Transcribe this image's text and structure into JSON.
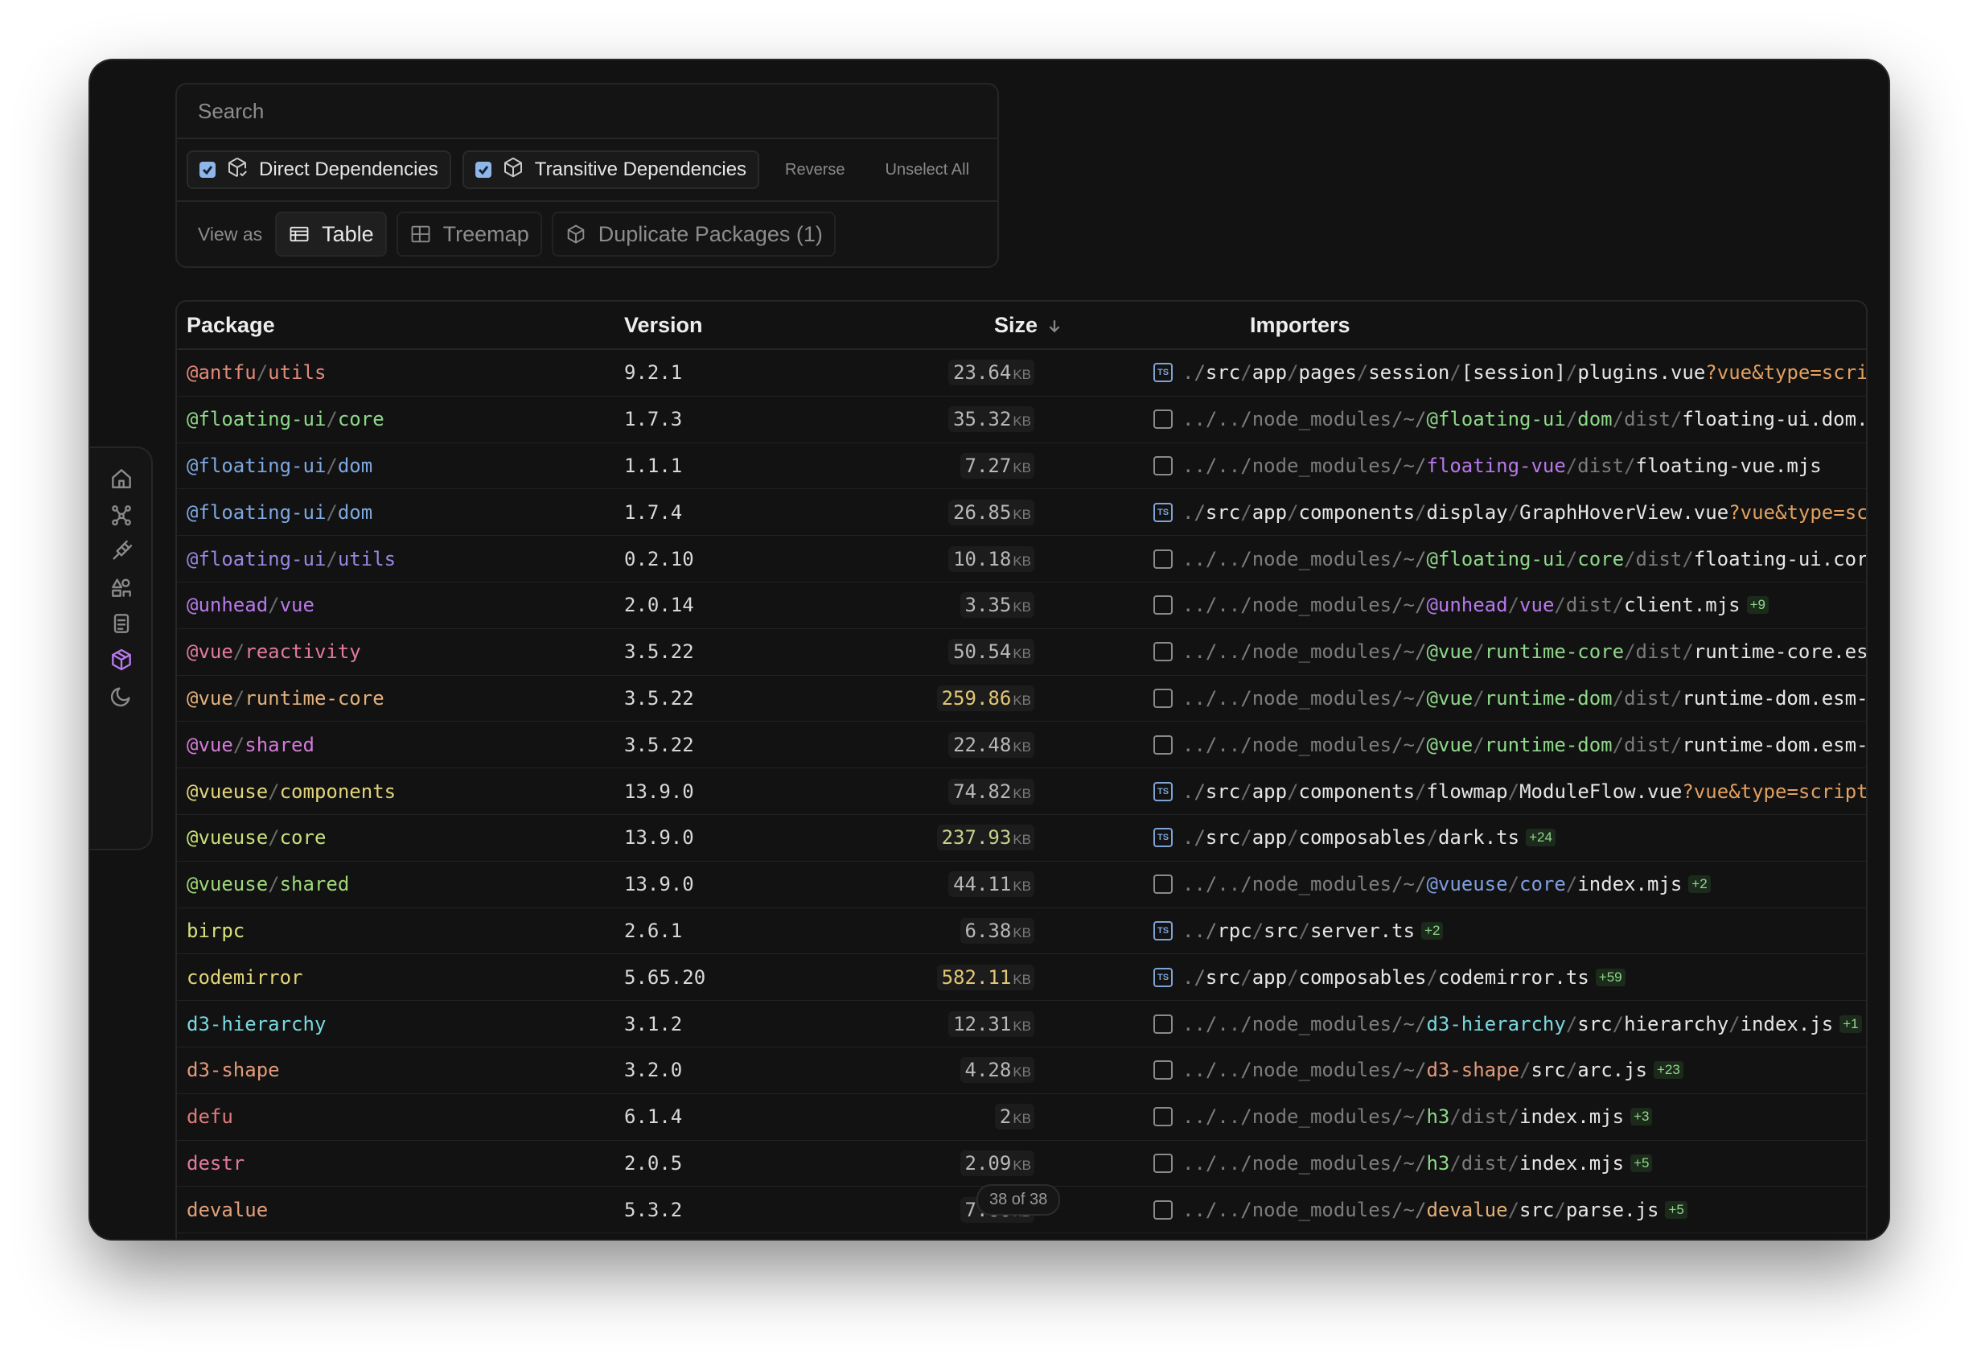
{
  "search": {
    "placeholder": "Search"
  },
  "filters": {
    "direct_label": "Direct Dependencies",
    "transitive_label": "Transitive Dependencies",
    "reverse_label": "Reverse",
    "unselect_label": "Unselect All"
  },
  "view": {
    "label": "View as",
    "table": "Table",
    "treemap": "Treemap",
    "duplicates": "Duplicate Packages (1)"
  },
  "rail": {
    "items": [
      "home-icon",
      "graph-icon",
      "plugin-icon",
      "assets-icon",
      "docs-icon",
      "packages-icon",
      "moon-icon"
    ],
    "active": "packages-icon"
  },
  "table": {
    "headers": {
      "package": "Package",
      "version": "Version",
      "size": "Size",
      "importers": "Importers"
    },
    "rows": [
      {
        "scope": "@antfu",
        "name": "utils",
        "color": "#e28a7a",
        "version": "9.2.1",
        "size": "23.64",
        "unit": "KB",
        "tone": "",
        "file": "ts",
        "importer": [
          [
            "./",
            "d"
          ],
          [
            "src",
            "t"
          ],
          [
            "/",
            "s"
          ],
          [
            "app",
            "t"
          ],
          [
            "/",
            "s"
          ],
          [
            "pages",
            "t"
          ],
          [
            "/",
            "s"
          ],
          [
            "session",
            "t"
          ],
          [
            "/",
            "s"
          ],
          [
            "[session]",
            "t"
          ],
          [
            "/",
            "s"
          ],
          [
            "plugins.vue",
            "t"
          ],
          [
            "?",
            "o"
          ],
          [
            "vue",
            "o"
          ],
          [
            "&",
            "o"
          ],
          [
            "type",
            "o"
          ],
          [
            "=script",
            "o"
          ]
        ],
        "extra": ""
      },
      {
        "scope": "@floating-ui",
        "name": "core",
        "color": "#8fd88a",
        "version": "1.7.3",
        "size": "35.32",
        "unit": "KB",
        "tone": "",
        "file": "js",
        "importer": [
          [
            "../../node_modules/~/",
            "d"
          ],
          [
            "@floating-ui",
            "g"
          ],
          [
            "/",
            "s"
          ],
          [
            "dom",
            "g"
          ],
          [
            "/",
            "s"
          ],
          [
            "dist",
            "d"
          ],
          [
            "/",
            "s"
          ],
          [
            "floating-ui.dom.mjs",
            "t"
          ]
        ],
        "extra": ""
      },
      {
        "scope": "@floating-ui",
        "name": "dom",
        "color": "#7fa8e0",
        "version": "1.1.1",
        "size": "7.27",
        "unit": "KB",
        "tone": "",
        "file": "js",
        "importer": [
          [
            "../../node_modules/~/",
            "d"
          ],
          [
            "floating-vue",
            "p"
          ],
          [
            "/",
            "s"
          ],
          [
            "dist",
            "d"
          ],
          [
            "/",
            "s"
          ],
          [
            "floating-vue.mjs",
            "t"
          ]
        ],
        "extra": ""
      },
      {
        "scope": "@floating-ui",
        "name": "dom",
        "color": "#7fa8e0",
        "version": "1.7.4",
        "size": "26.85",
        "unit": "KB",
        "tone": "",
        "file": "ts",
        "importer": [
          [
            "./",
            "d"
          ],
          [
            "src",
            "t"
          ],
          [
            "/",
            "s"
          ],
          [
            "app",
            "t"
          ],
          [
            "/",
            "s"
          ],
          [
            "components",
            "t"
          ],
          [
            "/",
            "s"
          ],
          [
            "display",
            "t"
          ],
          [
            "/",
            "s"
          ],
          [
            "GraphHoverView.vue",
            "t"
          ],
          [
            "?",
            "o"
          ],
          [
            "vue",
            "o"
          ],
          [
            "&",
            "o"
          ],
          [
            "type",
            "o"
          ],
          [
            "=script",
            "o"
          ]
        ],
        "extra": ""
      },
      {
        "scope": "@floating-ui",
        "name": "utils",
        "color": "#9a86e0",
        "version": "0.2.10",
        "size": "10.18",
        "unit": "KB",
        "tone": "",
        "file": "js",
        "importer": [
          [
            "../../node_modules/~/",
            "d"
          ],
          [
            "@floating-ui",
            "g"
          ],
          [
            "/",
            "s"
          ],
          [
            "core",
            "g"
          ],
          [
            "/",
            "s"
          ],
          [
            "dist",
            "d"
          ],
          [
            "/",
            "s"
          ],
          [
            "floating-ui.core.mjs",
            "t"
          ]
        ],
        "extra": ""
      },
      {
        "scope": "@unhead",
        "name": "vue",
        "color": "#b779ea",
        "version": "2.0.14",
        "size": "3.35",
        "unit": "KB",
        "tone": "",
        "file": "js",
        "importer": [
          [
            "../../node_modules/~/",
            "d"
          ],
          [
            "@unhead",
            "p"
          ],
          [
            "/",
            "s"
          ],
          [
            "vue",
            "p"
          ],
          [
            "/",
            "s"
          ],
          [
            "dist",
            "d"
          ],
          [
            "/",
            "s"
          ],
          [
            "client.mjs",
            "t"
          ]
        ],
        "extra": "+9"
      },
      {
        "scope": "@vue",
        "name": "reactivity",
        "color": "#e47a9c",
        "version": "3.5.22",
        "size": "50.54",
        "unit": "KB",
        "tone": "",
        "file": "js",
        "importer": [
          [
            "../../node_modules/~/",
            "d"
          ],
          [
            "@vue",
            "g"
          ],
          [
            "/",
            "s"
          ],
          [
            "runtime-core",
            "g"
          ],
          [
            "/",
            "s"
          ],
          [
            "dist",
            "d"
          ],
          [
            "/",
            "s"
          ],
          [
            "runtime-core.esm-bundler.js",
            "t"
          ]
        ],
        "extra": ""
      },
      {
        "scope": "@vue",
        "name": "runtime-core",
        "color": "#e2b07a",
        "version": "3.5.22",
        "size": "259.86",
        "unit": "KB",
        "tone": "big",
        "file": "js",
        "importer": [
          [
            "../../node_modules/~/",
            "d"
          ],
          [
            "@vue",
            "g"
          ],
          [
            "/",
            "s"
          ],
          [
            "runtime-dom",
            "g"
          ],
          [
            "/",
            "s"
          ],
          [
            "dist",
            "d"
          ],
          [
            "/",
            "s"
          ],
          [
            "runtime-dom.esm-bundler.js",
            "t"
          ]
        ],
        "extra": ""
      },
      {
        "scope": "@vue",
        "name": "shared",
        "color": "#d37ad8",
        "version": "3.5.22",
        "size": "22.48",
        "unit": "KB",
        "tone": "",
        "file": "js",
        "importer": [
          [
            "../../node_modules/~/",
            "d"
          ],
          [
            "@vue",
            "g"
          ],
          [
            "/",
            "s"
          ],
          [
            "runtime-dom",
            "g"
          ],
          [
            "/",
            "s"
          ],
          [
            "dist",
            "d"
          ],
          [
            "/",
            "s"
          ],
          [
            "runtime-dom.esm-bundler.js",
            "t"
          ]
        ],
        "extra": ""
      },
      {
        "scope": "@vueuse",
        "name": "components",
        "color": "#e2d47a",
        "version": "13.9.0",
        "size": "74.82",
        "unit": "KB",
        "tone": "",
        "file": "ts",
        "importer": [
          [
            "./",
            "d"
          ],
          [
            "src",
            "t"
          ],
          [
            "/",
            "s"
          ],
          [
            "app",
            "t"
          ],
          [
            "/",
            "s"
          ],
          [
            "components",
            "t"
          ],
          [
            "/",
            "s"
          ],
          [
            "flowmap",
            "t"
          ],
          [
            "/",
            "s"
          ],
          [
            "ModuleFlow.vue",
            "t"
          ],
          [
            "?",
            "o"
          ],
          [
            "vue",
            "o"
          ],
          [
            "&",
            "o"
          ],
          [
            "type",
            "o"
          ],
          [
            "=script",
            "o"
          ]
        ],
        "extra": ""
      },
      {
        "scope": "@vueuse",
        "name": "core",
        "color": "#c7e07a",
        "version": "13.9.0",
        "size": "237.93",
        "unit": "KB",
        "tone": "mid",
        "file": "ts",
        "importer": [
          [
            "./",
            "d"
          ],
          [
            "src",
            "t"
          ],
          [
            "/",
            "s"
          ],
          [
            "app",
            "t"
          ],
          [
            "/",
            "s"
          ],
          [
            "composables",
            "t"
          ],
          [
            "/",
            "s"
          ],
          [
            "dark.ts",
            "t"
          ]
        ],
        "extra": "+24"
      },
      {
        "scope": "@vueuse",
        "name": "shared",
        "color": "#9ed87a",
        "version": "13.9.0",
        "size": "44.11",
        "unit": "KB",
        "tone": "",
        "file": "js",
        "importer": [
          [
            "../../node_modules/~/",
            "d"
          ],
          [
            "@vueuse",
            "b"
          ],
          [
            "/",
            "s"
          ],
          [
            "core",
            "b"
          ],
          [
            "/",
            "s"
          ],
          [
            "index.mjs",
            "t"
          ]
        ],
        "extra": "+2"
      },
      {
        "scope": "",
        "name": "birpc",
        "color": "#d8e07a",
        "version": "2.6.1",
        "size": "6.38",
        "unit": "KB",
        "tone": "",
        "file": "ts",
        "importer": [
          [
            "../",
            "d"
          ],
          [
            "rpc",
            "t"
          ],
          [
            "/",
            "s"
          ],
          [
            "src",
            "t"
          ],
          [
            "/",
            "s"
          ],
          [
            "server.ts",
            "t"
          ]
        ],
        "extra": "+2"
      },
      {
        "scope": "",
        "name": "codemirror",
        "color": "#e2d47a",
        "version": "5.65.20",
        "size": "582.11",
        "unit": "KB",
        "tone": "big",
        "file": "ts",
        "importer": [
          [
            "./",
            "d"
          ],
          [
            "src",
            "t"
          ],
          [
            "/",
            "s"
          ],
          [
            "app",
            "t"
          ],
          [
            "/",
            "s"
          ],
          [
            "composables",
            "t"
          ],
          [
            "/",
            "s"
          ],
          [
            "codemirror.ts",
            "t"
          ]
        ],
        "extra": "+59"
      },
      {
        "scope": "",
        "name": "d3-hierarchy",
        "color": "#7ad8e0",
        "version": "3.1.2",
        "size": "12.31",
        "unit": "KB",
        "tone": "",
        "file": "js",
        "importer": [
          [
            "../../node_modules/~/",
            "d"
          ],
          [
            "d3-hierarchy",
            "c"
          ],
          [
            "/",
            "s"
          ],
          [
            "src",
            "t"
          ],
          [
            "/",
            "s"
          ],
          [
            "hierarchy",
            "t"
          ],
          [
            "/",
            "s"
          ],
          [
            "index.js",
            "t"
          ]
        ],
        "extra": "+1"
      },
      {
        "scope": "",
        "name": "d3-shape",
        "color": "#e29a7a",
        "version": "3.2.0",
        "size": "4.28",
        "unit": "KB",
        "tone": "",
        "file": "js",
        "importer": [
          [
            "../../node_modules/~/",
            "d"
          ],
          [
            "d3-shape",
            "r"
          ],
          [
            "/",
            "s"
          ],
          [
            "src",
            "t"
          ],
          [
            "/",
            "s"
          ],
          [
            "arc.js",
            "t"
          ]
        ],
        "extra": "+23"
      },
      {
        "scope": "",
        "name": "defu",
        "color": "#e27a7a",
        "version": "6.1.4",
        "size": "2",
        "unit": "KB",
        "tone": "",
        "file": "js",
        "importer": [
          [
            "../../node_modules/~/",
            "d"
          ],
          [
            "h3",
            "g"
          ],
          [
            "/",
            "s"
          ],
          [
            "dist",
            "d"
          ],
          [
            "/",
            "s"
          ],
          [
            "index.mjs",
            "t"
          ]
        ],
        "extra": "+3"
      },
      {
        "scope": "",
        "name": "destr",
        "color": "#e27a9a",
        "version": "2.0.5",
        "size": "2.09",
        "unit": "KB",
        "tone": "",
        "file": "js",
        "importer": [
          [
            "../../node_modules/~/",
            "d"
          ],
          [
            "h3",
            "g"
          ],
          [
            "/",
            "s"
          ],
          [
            "dist",
            "d"
          ],
          [
            "/",
            "s"
          ],
          [
            "index.mjs",
            "t"
          ]
        ],
        "extra": "+5"
      },
      {
        "scope": "",
        "name": "devalue",
        "color": "#e2a07a",
        "version": "5.3.2",
        "size": "7.60",
        "unit": "KB",
        "tone": "",
        "file": "js",
        "importer": [
          [
            "../../node_modules/~/",
            "d"
          ],
          [
            "devalue",
            "y"
          ],
          [
            "/",
            "s"
          ],
          [
            "src",
            "t"
          ],
          [
            "/",
            "s"
          ],
          [
            "parse.js",
            "t"
          ]
        ],
        "extra": "+5"
      }
    ]
  },
  "count": "38 of 38",
  "colors": {
    "background": "#121212",
    "border": "#262626",
    "accent": "#b779ea",
    "checkbox": "#8fb6e8"
  }
}
